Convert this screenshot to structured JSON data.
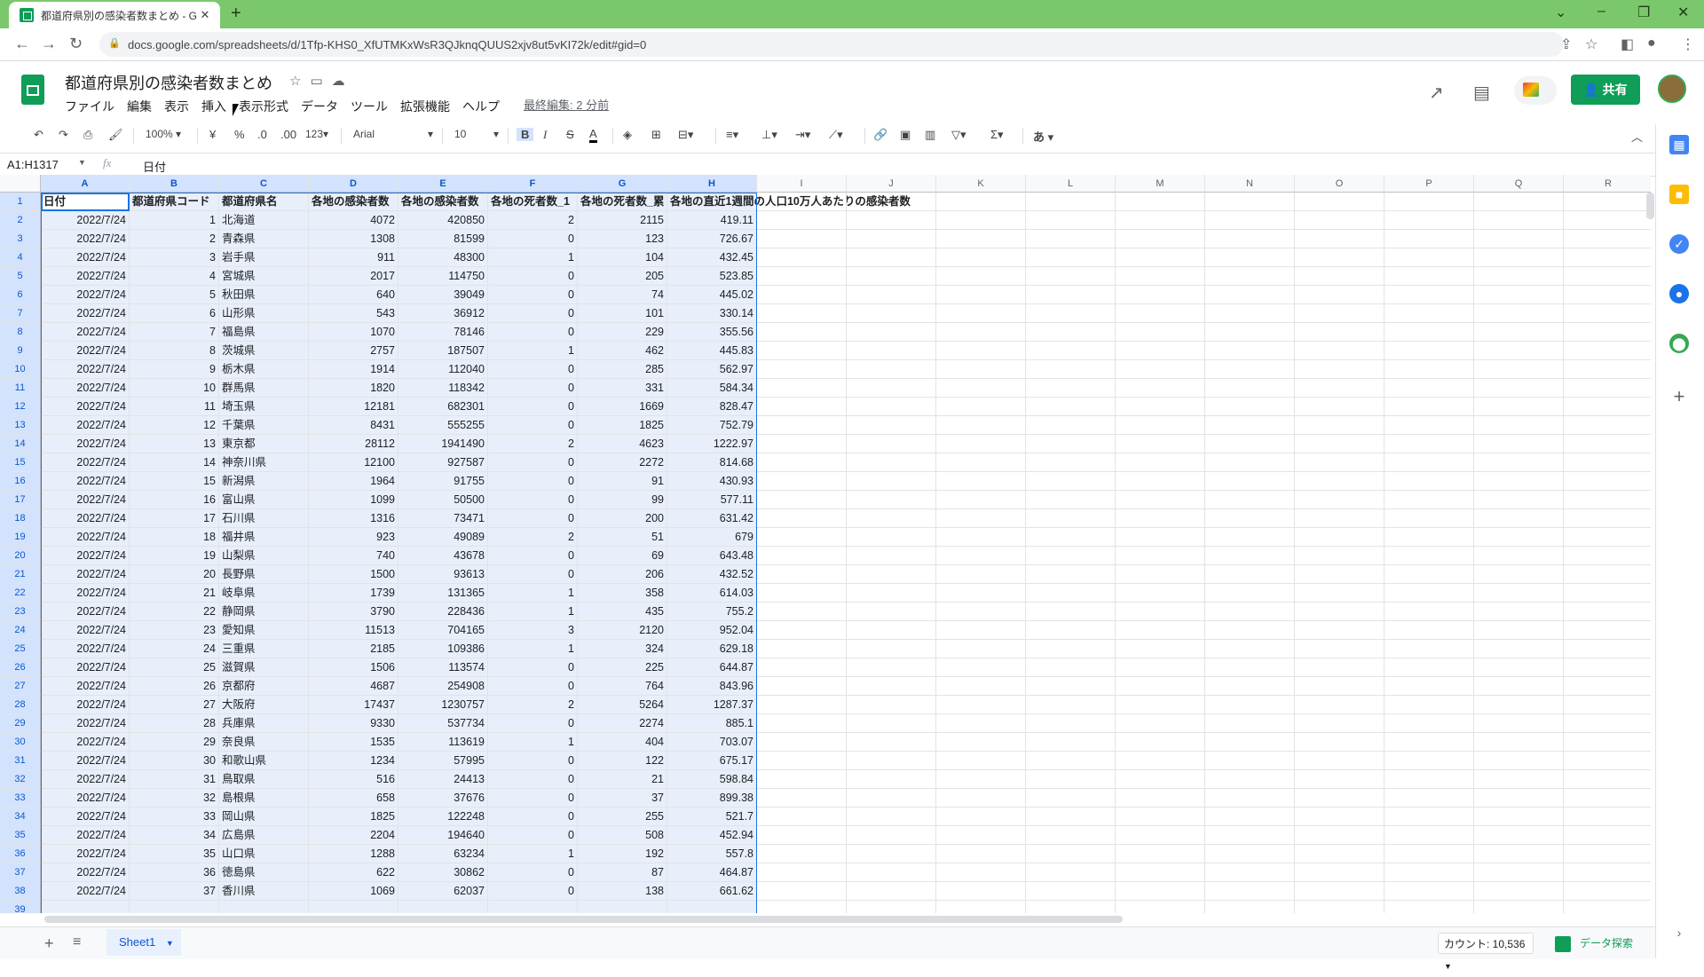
{
  "browser": {
    "tab_title": "都道府県別の感染者数まとめ - Go",
    "tab_close": "✕",
    "new_tab": "+",
    "url": "docs.google.com/spreadsheets/d/1Tfp-KHS0_XfUTMKxWsR3QJknqQUUS2xjv8ut5vKI72k/edit#gid=0"
  },
  "sheets": {
    "doc_title": "都道府県別の感染者数まとめ",
    "menu": [
      "ファイル",
      "編集",
      "表示",
      "挿入",
      "表示形式",
      "データ",
      "ツール",
      "拡張機能",
      "ヘルプ"
    ],
    "last_edit": "最終編集: 2 分前",
    "share_label": "共有",
    "toolbar": {
      "zoom": "100%",
      "currency": "¥",
      "percent": "%",
      "dec_less": ".0",
      "dec_more": ".00",
      "format_more": "123",
      "font": "Arial",
      "font_size": "10",
      "bold": "B",
      "italic": "I",
      "strike": "S",
      "text_color": "A",
      "input_tool": "あ"
    },
    "name_box": "A1:H1317",
    "fx": "fx",
    "formula_value": "日付"
  },
  "grid": {
    "columns": [
      "A",
      "B",
      "C",
      "D",
      "E",
      "F",
      "G",
      "H",
      "I",
      "J",
      "K",
      "L",
      "M",
      "N",
      "O",
      "P",
      "Q",
      "R"
    ],
    "header_row": [
      "日付",
      "都道府県コード",
      "都道府県名",
      "各地の感染者数",
      "各地の感染者数",
      "各地の死者数_1",
      "各地の死者数_累",
      "各地の直近1週間の人口10万人あたりの感染者数"
    ],
    "rows": [
      [
        "2022/7/24",
        "1",
        "北海道",
        "4072",
        "420850",
        "2",
        "2115",
        "419.11"
      ],
      [
        "2022/7/24",
        "2",
        "青森県",
        "1308",
        "81599",
        "0",
        "123",
        "726.67"
      ],
      [
        "2022/7/24",
        "3",
        "岩手県",
        "911",
        "48300",
        "1",
        "104",
        "432.45"
      ],
      [
        "2022/7/24",
        "4",
        "宮城県",
        "2017",
        "114750",
        "0",
        "205",
        "523.85"
      ],
      [
        "2022/7/24",
        "5",
        "秋田県",
        "640",
        "39049",
        "0",
        "74",
        "445.02"
      ],
      [
        "2022/7/24",
        "6",
        "山形県",
        "543",
        "36912",
        "0",
        "101",
        "330.14"
      ],
      [
        "2022/7/24",
        "7",
        "福島県",
        "1070",
        "78146",
        "0",
        "229",
        "355.56"
      ],
      [
        "2022/7/24",
        "8",
        "茨城県",
        "2757",
        "187507",
        "1",
        "462",
        "445.83"
      ],
      [
        "2022/7/24",
        "9",
        "栃木県",
        "1914",
        "112040",
        "0",
        "285",
        "562.97"
      ],
      [
        "2022/7/24",
        "10",
        "群馬県",
        "1820",
        "118342",
        "0",
        "331",
        "584.34"
      ],
      [
        "2022/7/24",
        "11",
        "埼玉県",
        "12181",
        "682301",
        "0",
        "1669",
        "828.47"
      ],
      [
        "2022/7/24",
        "12",
        "千葉県",
        "8431",
        "555255",
        "0",
        "1825",
        "752.79"
      ],
      [
        "2022/7/24",
        "13",
        "東京都",
        "28112",
        "1941490",
        "2",
        "4623",
        "1222.97"
      ],
      [
        "2022/7/24",
        "14",
        "神奈川県",
        "12100",
        "927587",
        "0",
        "2272",
        "814.68"
      ],
      [
        "2022/7/24",
        "15",
        "新潟県",
        "1964",
        "91755",
        "0",
        "91",
        "430.93"
      ],
      [
        "2022/7/24",
        "16",
        "富山県",
        "1099",
        "50500",
        "0",
        "99",
        "577.11"
      ],
      [
        "2022/7/24",
        "17",
        "石川県",
        "1316",
        "73471",
        "0",
        "200",
        "631.42"
      ],
      [
        "2022/7/24",
        "18",
        "福井県",
        "923",
        "49089",
        "2",
        "51",
        "679"
      ],
      [
        "2022/7/24",
        "19",
        "山梨県",
        "740",
        "43678",
        "0",
        "69",
        "643.48"
      ],
      [
        "2022/7/24",
        "20",
        "長野県",
        "1500",
        "93613",
        "0",
        "206",
        "432.52"
      ],
      [
        "2022/7/24",
        "21",
        "岐阜県",
        "1739",
        "131365",
        "1",
        "358",
        "614.03"
      ],
      [
        "2022/7/24",
        "22",
        "静岡県",
        "3790",
        "228436",
        "1",
        "435",
        "755.2"
      ],
      [
        "2022/7/24",
        "23",
        "愛知県",
        "11513",
        "704165",
        "3",
        "2120",
        "952.04"
      ],
      [
        "2022/7/24",
        "24",
        "三重県",
        "2185",
        "109386",
        "1",
        "324",
        "629.18"
      ],
      [
        "2022/7/24",
        "25",
        "滋賀県",
        "1506",
        "113574",
        "0",
        "225",
        "644.87"
      ],
      [
        "2022/7/24",
        "26",
        "京都府",
        "4687",
        "254908",
        "0",
        "764",
        "843.96"
      ],
      [
        "2022/7/24",
        "27",
        "大阪府",
        "17437",
        "1230757",
        "2",
        "5264",
        "1287.37"
      ],
      [
        "2022/7/24",
        "28",
        "兵庫県",
        "9330",
        "537734",
        "0",
        "2274",
        "885.1"
      ],
      [
        "2022/7/24",
        "29",
        "奈良県",
        "1535",
        "113619",
        "1",
        "404",
        "703.07"
      ],
      [
        "2022/7/24",
        "30",
        "和歌山県",
        "1234",
        "57995",
        "0",
        "122",
        "675.17"
      ],
      [
        "2022/7/24",
        "31",
        "鳥取県",
        "516",
        "24413",
        "0",
        "21",
        "598.84"
      ],
      [
        "2022/7/24",
        "32",
        "島根県",
        "658",
        "37676",
        "0",
        "37",
        "899.38"
      ],
      [
        "2022/7/24",
        "33",
        "岡山県",
        "1825",
        "122248",
        "0",
        "255",
        "521.7"
      ],
      [
        "2022/7/24",
        "34",
        "広島県",
        "2204",
        "194640",
        "0",
        "508",
        "452.94"
      ],
      [
        "2022/7/24",
        "35",
        "山口県",
        "1288",
        "63234",
        "1",
        "192",
        "557.8"
      ],
      [
        "2022/7/24",
        "36",
        "徳島県",
        "622",
        "30862",
        "0",
        "87",
        "464.87"
      ],
      [
        "2022/7/24",
        "37",
        "香川県",
        "1069",
        "62037",
        "0",
        "138",
        "661.62"
      ]
    ]
  },
  "bottom": {
    "add_sheet": "+",
    "all_sheets": "≡",
    "sheet_name": "Sheet1",
    "count": "カウント: 10,536",
    "explore": "データ探索"
  },
  "colors": {
    "tabstrip": "#7bc86c",
    "brand_green": "#0f9d58",
    "selection": "#e8effb",
    "selection_border": "#1a73e8"
  },
  "icons": [
    "undo-icon",
    "redo-icon",
    "print-icon",
    "paint-format-icon",
    "fill-color-icon",
    "borders-icon",
    "merge-icon",
    "align-icon",
    "valign-icon",
    "wrap-icon",
    "rotate-icon",
    "link-icon",
    "comment-icon",
    "chart-icon",
    "filter-icon",
    "sum-icon"
  ]
}
